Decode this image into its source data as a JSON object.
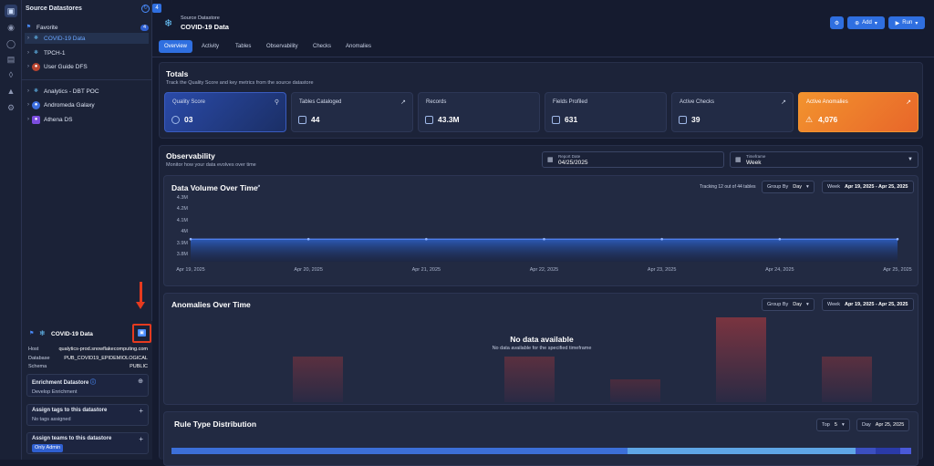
{
  "sidebar": {
    "title": "Source Datastores",
    "favorite_label": "Favorite",
    "favorite_count": "4",
    "collapse_badge": "4",
    "items": [
      {
        "label": "COVID-19 Data"
      },
      {
        "label": "TPCH-1"
      },
      {
        "label": "User Guide DFS"
      },
      {
        "label": "Analytics - DBT POC"
      },
      {
        "label": "Andromeda Galaxy"
      },
      {
        "label": "Athena DS"
      }
    ],
    "details": {
      "name": "COVID-19 Data",
      "host_label": "Host",
      "host_value": "qualytics-prod.snowflakecomputing.com",
      "database_label": "Database",
      "database_value": "PUB_COVID19_EPIDEMIOLOGICAL",
      "schema_label": "Schema",
      "schema_value": "PUBLIC",
      "enrichment_title": "Enrichment Datastore",
      "enrichment_value": "Develop Enrichment",
      "tags_title": "Assign tags to this datastore",
      "tags_value": "No tags assigned",
      "teams_title": "Assign teams to this datastore",
      "teams_value": "Only Admin"
    }
  },
  "header": {
    "subtitle": "Source Datastore",
    "title": "COVID-19 Data",
    "add_label": "Add",
    "run_label": "Run"
  },
  "tabs": [
    "Overview",
    "Activity",
    "Tables",
    "Observability",
    "Checks",
    "Anomalies"
  ],
  "totals": {
    "title": "Totals",
    "subtitle": "Track the Quality Score and key metrics from the source datastore",
    "cards": [
      {
        "label": "Quality Score",
        "value": "03"
      },
      {
        "label": "Tables Cataloged",
        "value": "44"
      },
      {
        "label": "Records",
        "value": "43.3M"
      },
      {
        "label": "Fields Profiled",
        "value": "631"
      },
      {
        "label": "Active Checks",
        "value": "39"
      },
      {
        "label": "Active Anomalies",
        "value": "4,076"
      }
    ]
  },
  "observability": {
    "title": "Observability",
    "subtitle": "Monitor how your data evolves over time",
    "report_date_label": "Report Date",
    "report_date_value": "04/25/2025",
    "timeframe_label": "Timeframe",
    "timeframe_value": "Week"
  },
  "volume": {
    "title": "Data Volume Over Time",
    "tracking": "Tracking 12 out of 44 tables",
    "group_by_label": "Group By",
    "group_by_value": "Day",
    "week_label": "Week",
    "range_value": "Apr 19, 2025 - Apr 25, 2025"
  },
  "anomalies": {
    "title": "Anomalies Over Time",
    "group_by_label": "Group By",
    "group_by_value": "Day",
    "week_label": "Week",
    "range_value": "Apr 19, 2025 - Apr 25, 2025",
    "empty_title": "No data available",
    "empty_sub": "No data available for the specified timeframe"
  },
  "rules": {
    "title": "Rule Type Distribution",
    "top_label": "Top",
    "top_value": "5",
    "day_label": "Day",
    "date_value": "Apr 25, 2025"
  },
  "chart_data": {
    "type": "area",
    "title": "Data Volume Over Time",
    "x": [
      "Apr 19, 2025",
      "Apr 20, 2025",
      "Apr 21, 2025",
      "Apr 22, 2025",
      "Apr 23, 2025",
      "Apr 24, 2025",
      "Apr 25, 2025"
    ],
    "y_ticks": [
      "4.3M",
      "4.2M",
      "4.1M",
      "4M",
      "3.9M",
      "3.8M"
    ],
    "ylim": [
      3.8,
      4.3
    ],
    "series": [
      {
        "values": [
          4.0,
          4.0,
          4.0,
          4.0,
          4.0,
          4.0,
          4.0
        ]
      }
    ]
  },
  "colors": {
    "accent": "#2f6fe0",
    "anomaly_card": "#f08a2a"
  }
}
